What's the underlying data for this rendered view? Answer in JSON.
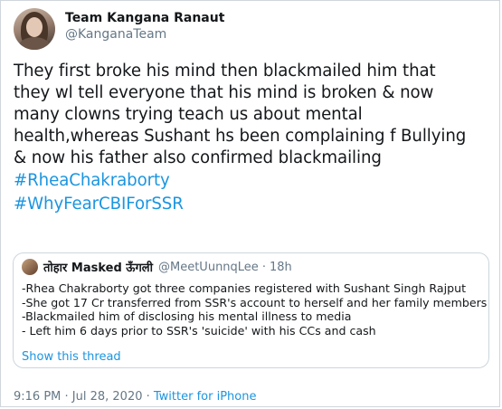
{
  "author": {
    "display_name": "Team Kangana Ranaut",
    "handle": "@KanganaTeam"
  },
  "tweet": {
    "lines": [
      "They first broke his mind then blackmailed him that",
      "they wl tell everyone that his mind is broken & now",
      "many clowns trying teach us about mental",
      "health,whereas Sushant hs been complaining f Bullying",
      "& now his father also confirmed blackmailing"
    ],
    "hashtags": [
      "#RheaChakraborty",
      "#WhyFearCBIForSSR"
    ]
  },
  "quoted_tweet": {
    "display_name": "तोहार Masked ऊँगली",
    "handle": "@MeetUunnqLee",
    "separator": "·",
    "time": "18h",
    "lines": [
      "-Rhea Chakraborty got three companies registered with Sushant Singh Rajput",
      "-She got 17 Cr transferred from SSR's account to herself and her family members",
      "-Blackmailed him of disclosing his mental illness to media",
      "- Left him 6 days prior to SSR's 'suicide' with his CCs and cash"
    ],
    "show_thread_label": "Show this thread"
  },
  "footer": {
    "timestamp": "9:16 PM · Jul 28, 2020 · ",
    "source": "Twitter for iPhone"
  },
  "colors": {
    "link": "#1b95e0",
    "secondary_text": "#657786",
    "border": "#ccd6dd"
  }
}
